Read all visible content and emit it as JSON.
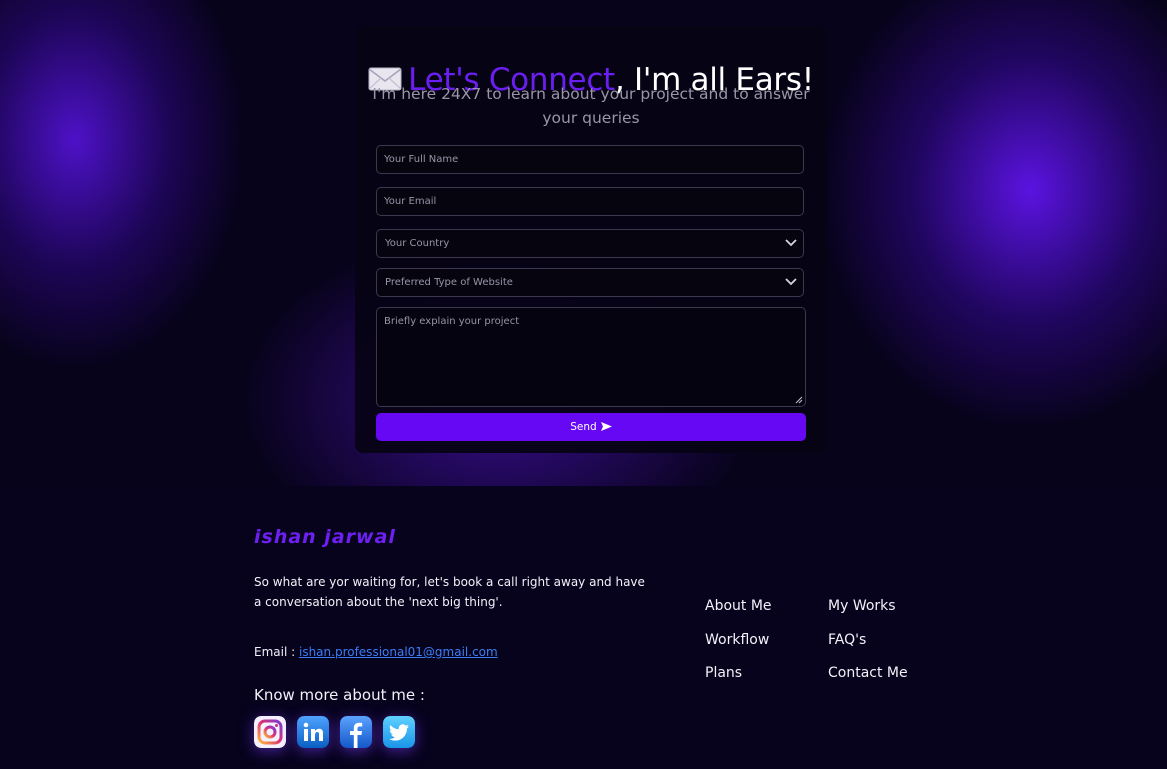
{
  "contact": {
    "title_accent": "Let's Connect",
    "title_rest": ", I'm all Ears!",
    "subtitle": "I'm here 24X7 to learn about your project and to answer your queries",
    "name_placeholder": "Your Full Name",
    "email_placeholder": "Your Email",
    "country_placeholder": "Your Country",
    "website_type_placeholder": "Preferred Type of Website",
    "project_placeholder": "Briefly explain your project",
    "send_label": "Send"
  },
  "footer": {
    "brand": "ishan jarwal",
    "blurb": "So what are yor waiting for, let's book a call right away and have a conversation about the 'next big thing'.",
    "email_label": "Email :",
    "email_value": "ishan.professional01@gmail.com",
    "know_more": "Know more about me :",
    "socials": [
      "instagram-icon",
      "linkedin-icon",
      "facebook-icon",
      "twitter-icon"
    ],
    "nav": {
      "about": "About Me",
      "works": "My Works",
      "workflow": "Workflow",
      "faqs": "FAQ's",
      "plans": "Plans",
      "contact": "Contact Me"
    }
  },
  "colors": {
    "accent": "#6a1ef0",
    "button": "#6708f5",
    "link": "#3b7df5",
    "background": "#07031a"
  }
}
